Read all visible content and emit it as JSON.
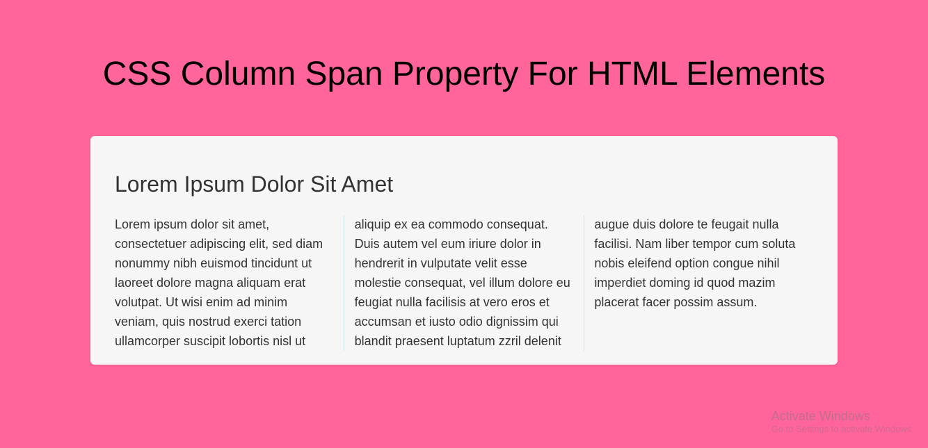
{
  "page_title": "CSS Column Span Property For HTML Elements",
  "content": {
    "heading": "Lorem Ipsum Dolor Sit Amet",
    "body": "Lorem ipsum dolor sit amet, consectetuer adipiscing elit, sed diam nonummy nibh euismod tincidunt ut laoreet dolore magna aliquam erat volutpat. Ut wisi enim ad minim veniam, quis nostrud exerci tation ullamcorper suscipit lobortis nisl ut aliquip ex ea commodo consequat. Duis autem vel eum iriure dolor in hendrerit in vulputate velit esse molestie consequat, vel illum dolore eu feugiat nulla facilisis at vero eros et accumsan et iusto odio dignissim qui blandit praesent luptatum zzril delenit augue duis dolore te feugait nulla facilisi. Nam liber tempor cum soluta nobis eleifend option congue nihil imperdiet doming id quod mazim placerat facer possim assum."
  },
  "watermark": {
    "title": "Activate Windows",
    "subtitle": "Go to Settings to activate Windows."
  }
}
